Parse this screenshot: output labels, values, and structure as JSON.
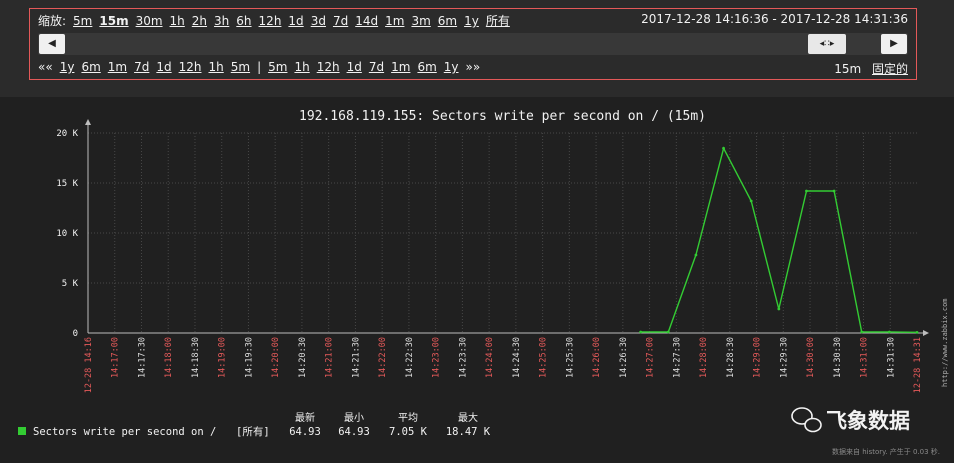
{
  "controls": {
    "zoom_label": "缩放:",
    "zoom_options": [
      {
        "label": "5m",
        "active": false
      },
      {
        "label": "15m",
        "active": true
      },
      {
        "label": "30m",
        "active": false
      },
      {
        "label": "1h",
        "active": false
      },
      {
        "label": "2h",
        "active": false
      },
      {
        "label": "3h",
        "active": false
      },
      {
        "label": "6h",
        "active": false
      },
      {
        "label": "12h",
        "active": false
      },
      {
        "label": "1d",
        "active": false
      },
      {
        "label": "3d",
        "active": false
      },
      {
        "label": "7d",
        "active": false
      },
      {
        "label": "14d",
        "active": false
      },
      {
        "label": "1m",
        "active": false
      },
      {
        "label": "3m",
        "active": false
      },
      {
        "label": "6m",
        "active": false
      },
      {
        "label": "1y",
        "active": false
      },
      {
        "label": "所有",
        "active": false
      }
    ],
    "period_range": "2017-12-28 14:16:36 - 2017-12-28 14:31:36",
    "scroll_left_glyph": "◀",
    "scroll_right_glyph": "▶",
    "scroll_thumb_glyph": "◂∷▸",
    "nav_back_glyph": "««",
    "nav_back": [
      "1y",
      "6m",
      "1m",
      "7d",
      "1d",
      "12h",
      "1h",
      "5m"
    ],
    "nav_separator": "|",
    "nav_forward": [
      "5m",
      "1h",
      "12h",
      "1d",
      "7d",
      "1m",
      "6m",
      "1y"
    ],
    "nav_forward_glyph": "»»",
    "period_length": "15m",
    "fixed_label": "固定的"
  },
  "chart_data": {
    "type": "line",
    "title": "192.168.119.155: Sectors write per second on / (15m)",
    "y_ticks": [
      "20 K",
      "15 K",
      "10 K",
      "5 K",
      "0"
    ],
    "ylim": [
      0,
      20000
    ],
    "grid": true,
    "x_labels": [
      {
        "t": "12-28 14:16",
        "red": true
      },
      {
        "t": "14:17:00",
        "red": true
      },
      {
        "t": "14:17:30",
        "red": false
      },
      {
        "t": "14:18:00",
        "red": true
      },
      {
        "t": "14:18:30",
        "red": false
      },
      {
        "t": "14:19:00",
        "red": true
      },
      {
        "t": "14:19:30",
        "red": false
      },
      {
        "t": "14:20:00",
        "red": true
      },
      {
        "t": "14:20:30",
        "red": false
      },
      {
        "t": "14:21:00",
        "red": true
      },
      {
        "t": "14:21:30",
        "red": false
      },
      {
        "t": "14:22:00",
        "red": true
      },
      {
        "t": "14:22:30",
        "red": false
      },
      {
        "t": "14:23:00",
        "red": true
      },
      {
        "t": "14:23:30",
        "red": false
      },
      {
        "t": "14:24:00",
        "red": true
      },
      {
        "t": "14:24:30",
        "red": false
      },
      {
        "t": "14:25:00",
        "red": true
      },
      {
        "t": "14:25:30",
        "red": false
      },
      {
        "t": "14:26:00",
        "red": true
      },
      {
        "t": "14:26:30",
        "red": false
      },
      {
        "t": "14:27:00",
        "red": true
      },
      {
        "t": "14:27:30",
        "red": false
      },
      {
        "t": "14:28:00",
        "red": true
      },
      {
        "t": "14:28:30",
        "red": false
      },
      {
        "t": "14:29:00",
        "red": true
      },
      {
        "t": "14:29:30",
        "red": false
      },
      {
        "t": "14:30:00",
        "red": true
      },
      {
        "t": "14:30:30",
        "red": false
      },
      {
        "t": "14:31:00",
        "red": true
      },
      {
        "t": "14:31:30",
        "red": false
      },
      {
        "t": "12-28 14:31",
        "red": true
      }
    ],
    "series": [
      {
        "name": "Sectors write per second on /",
        "color": "#33cc33",
        "x": [
          "14:26:36",
          "14:27:06",
          "14:27:36",
          "14:28:06",
          "14:28:36",
          "14:29:06",
          "14:29:36",
          "14:30:06",
          "14:30:36",
          "14:31:06",
          "14:31:36"
        ],
        "values": [
          100,
          100,
          7800,
          18470,
          13200,
          2400,
          14200,
          14200,
          100,
          100,
          65
        ]
      }
    ]
  },
  "legend": {
    "headers": [
      "最新",
      "最小",
      "平均",
      "最大"
    ],
    "name": "Sectors write per second on /",
    "scope": "[所有]",
    "values": [
      "64.93",
      "64.93",
      "7.05 K",
      "18.47 K"
    ]
  },
  "watermark_vertical": "http://www.zabbix.com",
  "footer_note": "数据来自 history. 产生于 0.03 秒.",
  "brand": {
    "text": "飞象数据",
    "icon": "wechat-icon"
  }
}
